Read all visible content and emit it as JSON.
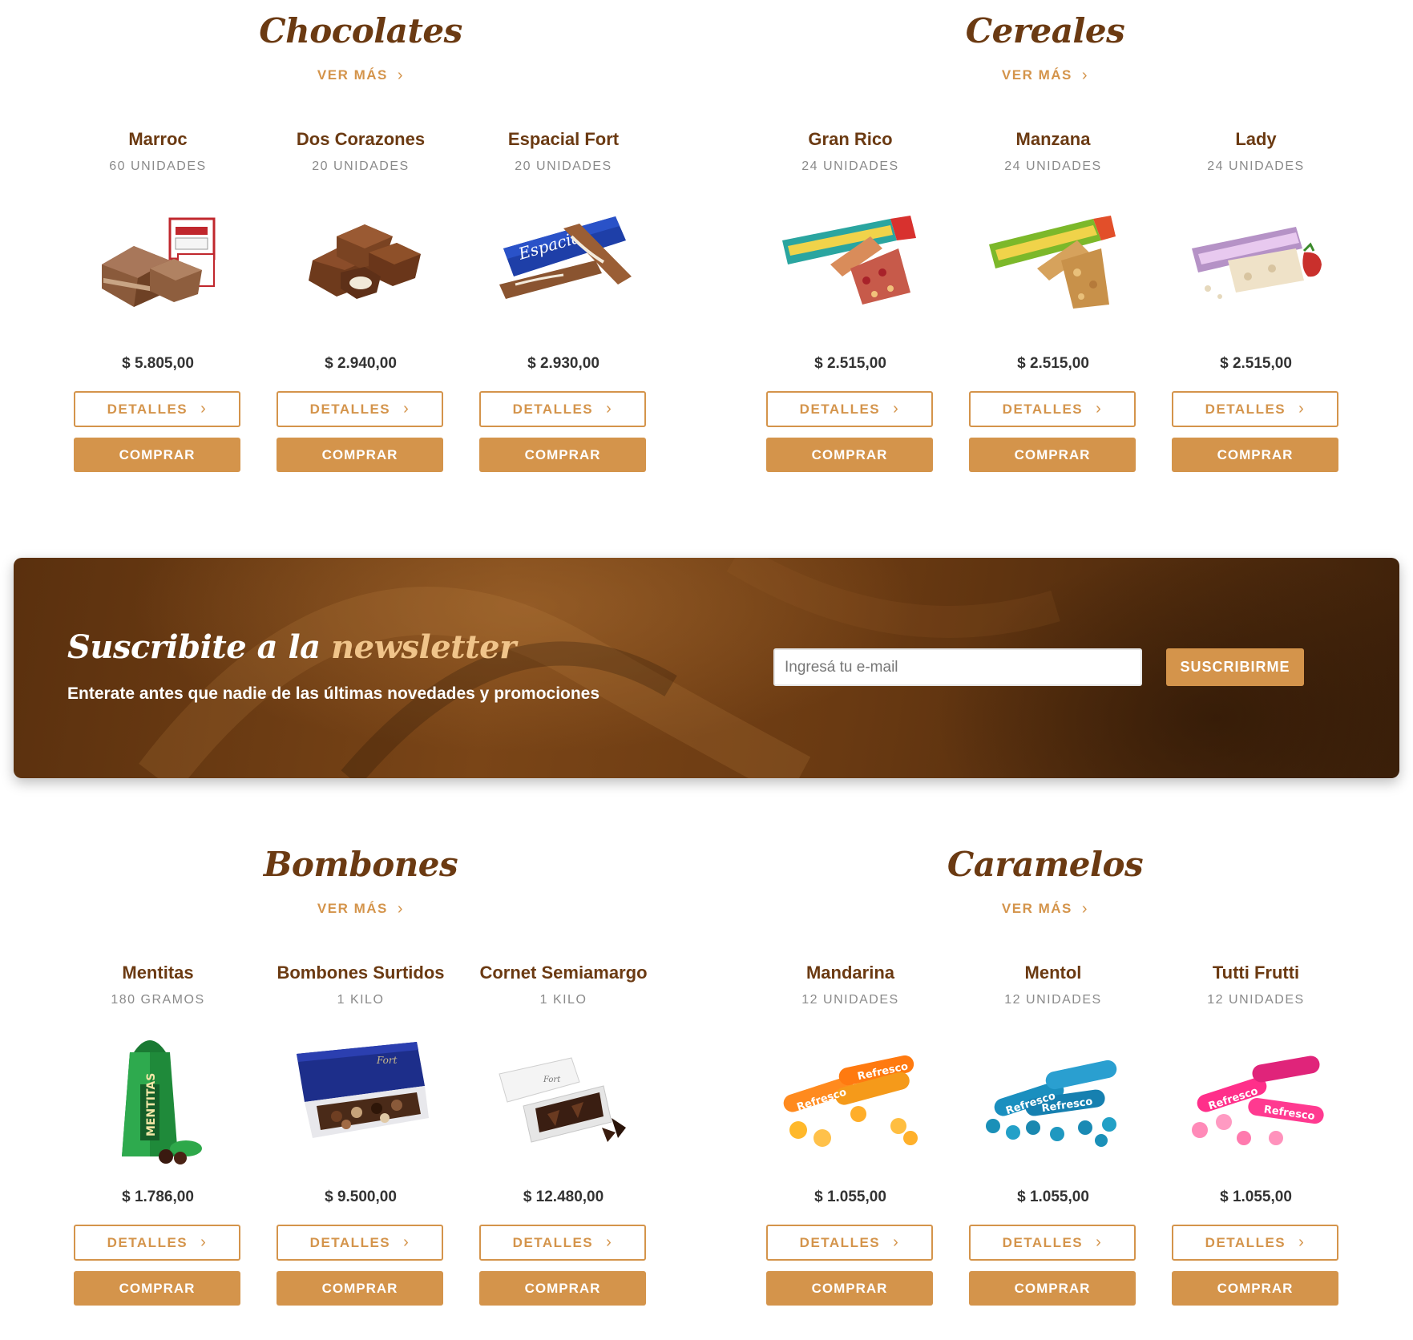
{
  "common": {
    "ver_mas": "VER MÁS",
    "detalles": "DETALLES",
    "comprar": "COMPRAR",
    "accent_color": "#d4944b",
    "title_color": "#6b3a12"
  },
  "categories": [
    {
      "title": "Chocolates",
      "products": [
        {
          "name": "Marroc",
          "qty": "60 UNIDADES",
          "price": "$ 5.805,00",
          "image": "chocolate-bar-image"
        },
        {
          "name": "Dos Corazones",
          "qty": "20 UNIDADES",
          "price": "$ 2.940,00",
          "image": "chocolate-pieces-image"
        },
        {
          "name": "Espacial Fort",
          "qty": "20 UNIDADES",
          "price": "$ 2.930,00",
          "image": "chocolate-bar-wrapped-image"
        }
      ]
    },
    {
      "title": "Cereales",
      "products": [
        {
          "name": "Gran Rico",
          "qty": "24 UNIDADES",
          "price": "$ 2.515,00",
          "image": "cereal-bar-image"
        },
        {
          "name": "Manzana",
          "qty": "24 UNIDADES",
          "price": "$ 2.515,00",
          "image": "cereal-bar-image"
        },
        {
          "name": "Lady",
          "qty": "24 UNIDADES",
          "price": "$ 2.515,00",
          "image": "cereal-bar-image"
        }
      ]
    },
    {
      "title": "Bombones",
      "products": [
        {
          "name": "Mentitas",
          "qty": "180 GRAMOS",
          "price": "$ 1.786,00",
          "image": "mint-box-image"
        },
        {
          "name": "Bombones Surtidos",
          "qty": "1 KILO",
          "price": "$ 9.500,00",
          "image": "bonbon-box-image"
        },
        {
          "name": "Cornet Semiamargo",
          "qty": "1 KILO",
          "price": "$ 12.480,00",
          "image": "cornet-box-image"
        }
      ]
    },
    {
      "title": "Caramelos",
      "products": [
        {
          "name": "Mandarina",
          "qty": "12 UNIDADES",
          "price": "$ 1.055,00",
          "image": "candy-roll-image"
        },
        {
          "name": "Mentol",
          "qty": "12 UNIDADES",
          "price": "$ 1.055,00",
          "image": "candy-roll-image"
        },
        {
          "name": "Tutti Frutti",
          "qty": "12 UNIDADES",
          "price": "$ 1.055,00",
          "image": "candy-roll-image"
        }
      ]
    }
  ],
  "newsletter": {
    "title_main": "Suscribite a la",
    "title_accent": "newsletter",
    "subtitle": "Enterate antes que nadie de las últimas novedades y promociones",
    "placeholder": "Ingresá tu e-mail",
    "button": "SUSCRIBIRME"
  }
}
